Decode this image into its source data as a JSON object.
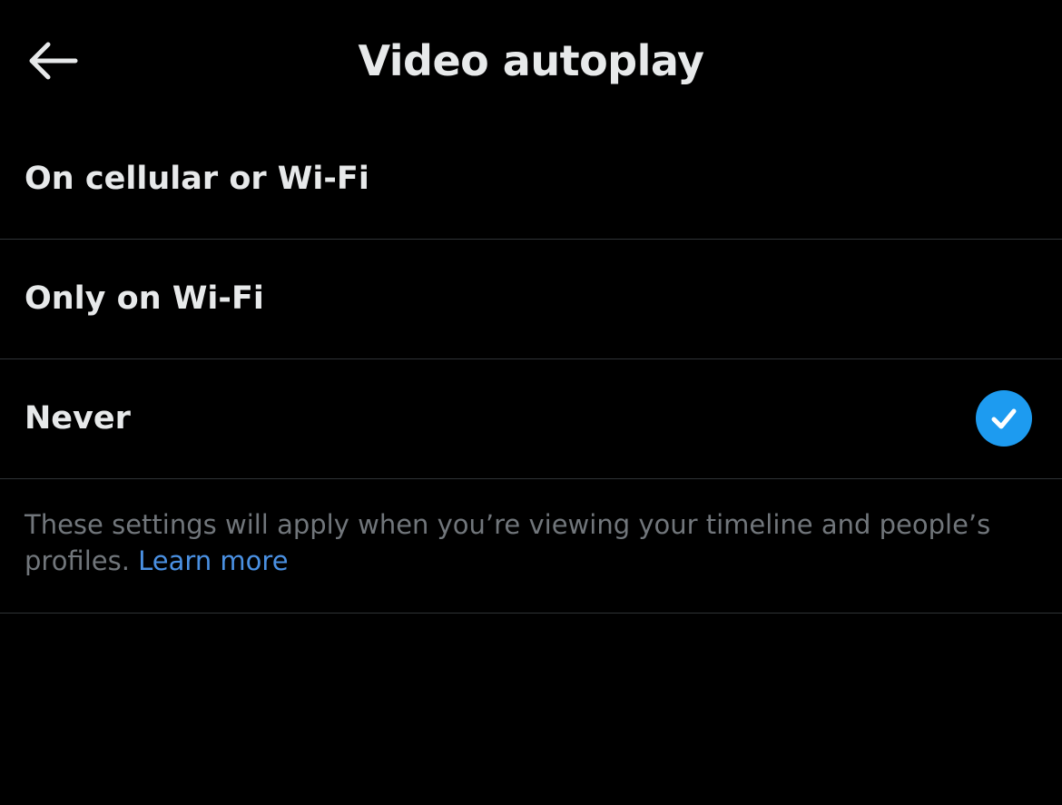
{
  "header": {
    "title": "Video autoplay",
    "back_icon": "arrow-left-icon"
  },
  "options": [
    {
      "label": "On cellular or Wi-Fi",
      "selected": false
    },
    {
      "label": "Only on Wi-Fi",
      "selected": false
    },
    {
      "label": "Never",
      "selected": true
    }
  ],
  "selected_icon": "checkmark-circle-icon",
  "footer": {
    "text": "These settings will apply when you’re viewing your timeline and people’s profiles. ",
    "link": "Learn more"
  },
  "colors": {
    "background": "#000000",
    "text": "#e7e9ea",
    "muted": "#71767b",
    "accent": "#1d9bf0",
    "link": "#4a90e2",
    "divider": "#2f3336"
  }
}
